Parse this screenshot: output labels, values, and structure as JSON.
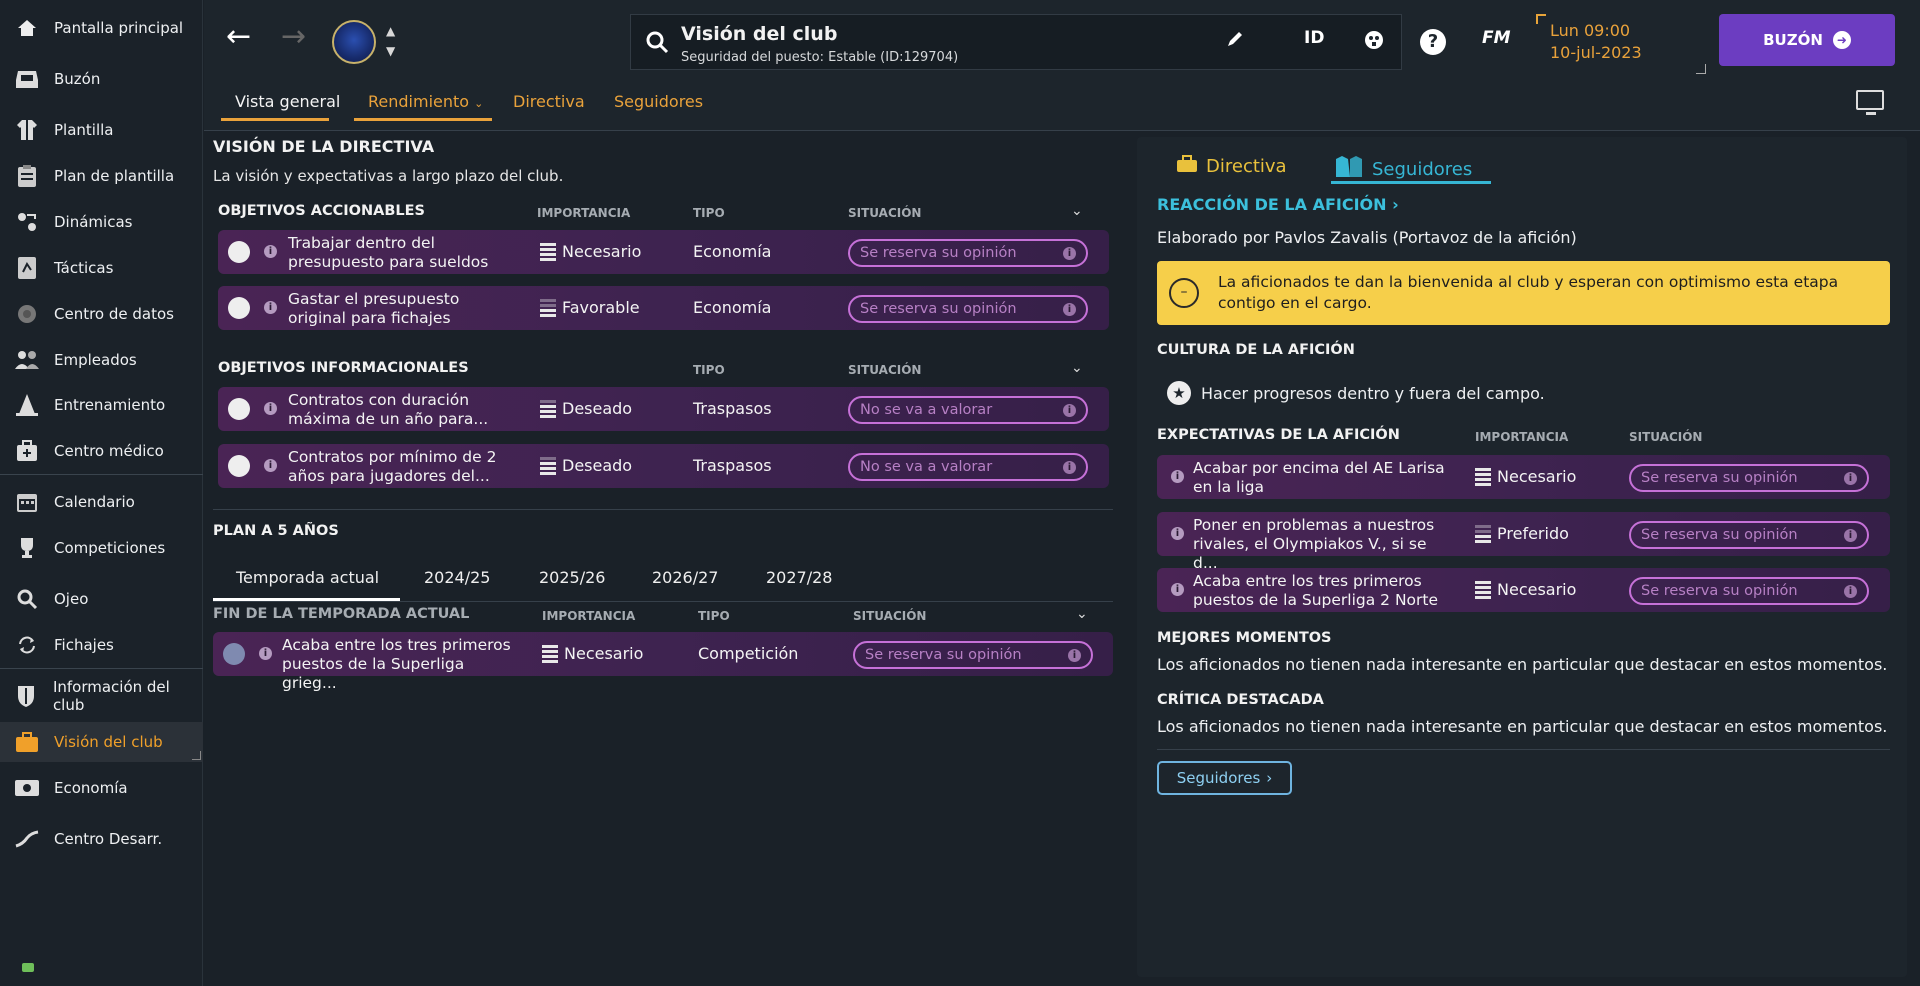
{
  "sidebar": {
    "items": [
      {
        "label": "Pantalla principal",
        "icon": "home-icon"
      },
      {
        "label": "Buzón",
        "icon": "inbox-icon"
      },
      {
        "label": "Plantilla",
        "icon": "shirt-icon"
      },
      {
        "label": "Plan de plantilla",
        "icon": "clipboard-icon"
      },
      {
        "label": "Dinámicas",
        "icon": "dynamics-icon"
      },
      {
        "label": "Tácticas",
        "icon": "tactics-board-icon"
      },
      {
        "label": "Centro de datos",
        "icon": "data-hub-icon"
      },
      {
        "label": "Empleados",
        "icon": "staff-icon"
      },
      {
        "label": "Entrenamiento",
        "icon": "training-cone-icon"
      },
      {
        "label": "Centro médico",
        "icon": "medical-kit-icon"
      },
      {
        "label": "Calendario",
        "icon": "calendar-icon"
      },
      {
        "label": "Competiciones",
        "icon": "trophy-icon"
      },
      {
        "label": "Ojeo",
        "icon": "magnifier-icon"
      },
      {
        "label": "Fichajes",
        "icon": "transfer-arrows-icon"
      },
      {
        "label": "Información del club",
        "icon": "club-shield-icon"
      },
      {
        "label": "Visión del club",
        "icon": "briefcase-icon"
      },
      {
        "label": "Economía",
        "icon": "banknote-icon"
      },
      {
        "label": "Centro Desarr.",
        "icon": "development-chart-icon"
      }
    ],
    "active": "Visión del club"
  },
  "topbar": {
    "title": "Visión del club",
    "subtitle": "Seguridad del puesto: Estable (ID:129704)",
    "id_label": "ID",
    "fm_label": "FM",
    "help_label": "?",
    "date_line1": "Lun 09:00",
    "date_line2": "10-jul-2023",
    "buzon_label": "BUZÓN"
  },
  "tabs": {
    "items": [
      "Vista general",
      "Rendimiento",
      "Directiva",
      "Seguidores"
    ],
    "active": "Vista general"
  },
  "directiva": {
    "heading": "VISIÓN DE LA DIRECTIVA",
    "subheading": "La visión y expectativas a largo plazo del club.",
    "col_importancia": "IMPORTANCIA",
    "col_tipo": "TIPO",
    "col_situacion": "SITUACIÓN",
    "accionables": {
      "title": "OBJETIVOS ACCIONABLES",
      "rows": [
        {
          "text": "Trabajar dentro del presupuesto para sueldos",
          "importancia": "Necesario",
          "tipo": "Economía",
          "situacion": "Se reserva su opinión"
        },
        {
          "text": "Gastar el presupuesto original para fichajes",
          "importancia": "Favorable",
          "tipo": "Economía",
          "situacion": "Se reserva su opinión"
        }
      ]
    },
    "informacionales": {
      "title": "OBJETIVOS INFORMACIONALES",
      "rows": [
        {
          "text": "Contratos con duración máxima de un año para...",
          "importancia": "Deseado",
          "tipo": "Traspasos",
          "situacion": "No se va a valorar"
        },
        {
          "text": "Contratos por mínimo de 2 años para jugadores del...",
          "importancia": "Deseado",
          "tipo": "Traspasos",
          "situacion": "No se va a valorar"
        }
      ]
    },
    "plan": {
      "title": "PLAN A 5 AÑOS",
      "years": [
        "Temporada actual",
        "2024/25",
        "2025/26",
        "2026/27",
        "2027/28"
      ],
      "active_year": "Temporada actual",
      "section": "FIN DE LA TEMPORADA ACTUAL",
      "rows": [
        {
          "text": "Acaba entre los tres primeros puestos de la Superliga grieg...",
          "importancia": "Necesario",
          "tipo": "Competición",
          "situacion": "Se reserva su opinión"
        }
      ]
    }
  },
  "panel": {
    "tabs": [
      "Directiva",
      "Seguidores"
    ],
    "active_tab": "Seguidores",
    "reaccion_title": "REACCIÓN DE LA AFICIÓN",
    "elaborado": "Elaborado por Pavlos Zavalis (Portavoz de la afición)",
    "banner_icon": "–",
    "banner": "La aficionados te dan la bienvenida al club y esperan con optimismo esta etapa contigo en el cargo.",
    "cultura_title": "CULTURA DE LA AFICIÓN",
    "cultura_item": "Hacer progresos dentro y fuera del campo.",
    "expectativas_title": "EXPECTATIVAS DE LA AFICIÓN",
    "col_importancia": "IMPORTANCIA",
    "col_situacion": "SITUACIÓN",
    "expectativas": [
      {
        "text": "Acabar por encima del AE Larisa en la liga",
        "importancia": "Necesario",
        "situacion": "Se reserva su opinión"
      },
      {
        "text": "Poner en problemas a nuestros rivales, el Olympiakos V., si se d...",
        "importancia": "Preferido",
        "situacion": "Se reserva su opinión"
      },
      {
        "text": "Acaba entre los tres primeros puestos de la Superliga 2 Norte",
        "importancia": "Necesario",
        "situacion": "Se reserva su opinión"
      }
    ],
    "mejores_title": "MEJORES MOMENTOS",
    "mejores_text": "Los aficionados no tienen nada interesante en particular que destacar en estos momentos.",
    "critica_title": "CRÍTICA DESTACADA",
    "critica_text": "Los aficionados no tienen nada interesante en particular que destacar en estos momentos.",
    "button_label": "Seguidores"
  },
  "colors": {
    "accent_orange": "#e9a23b",
    "accent_purple": "#6c3dc1",
    "pill_border": "#c671d8",
    "banner_yellow": "#f6cf4a",
    "link_cyan": "#3cc0dc"
  }
}
